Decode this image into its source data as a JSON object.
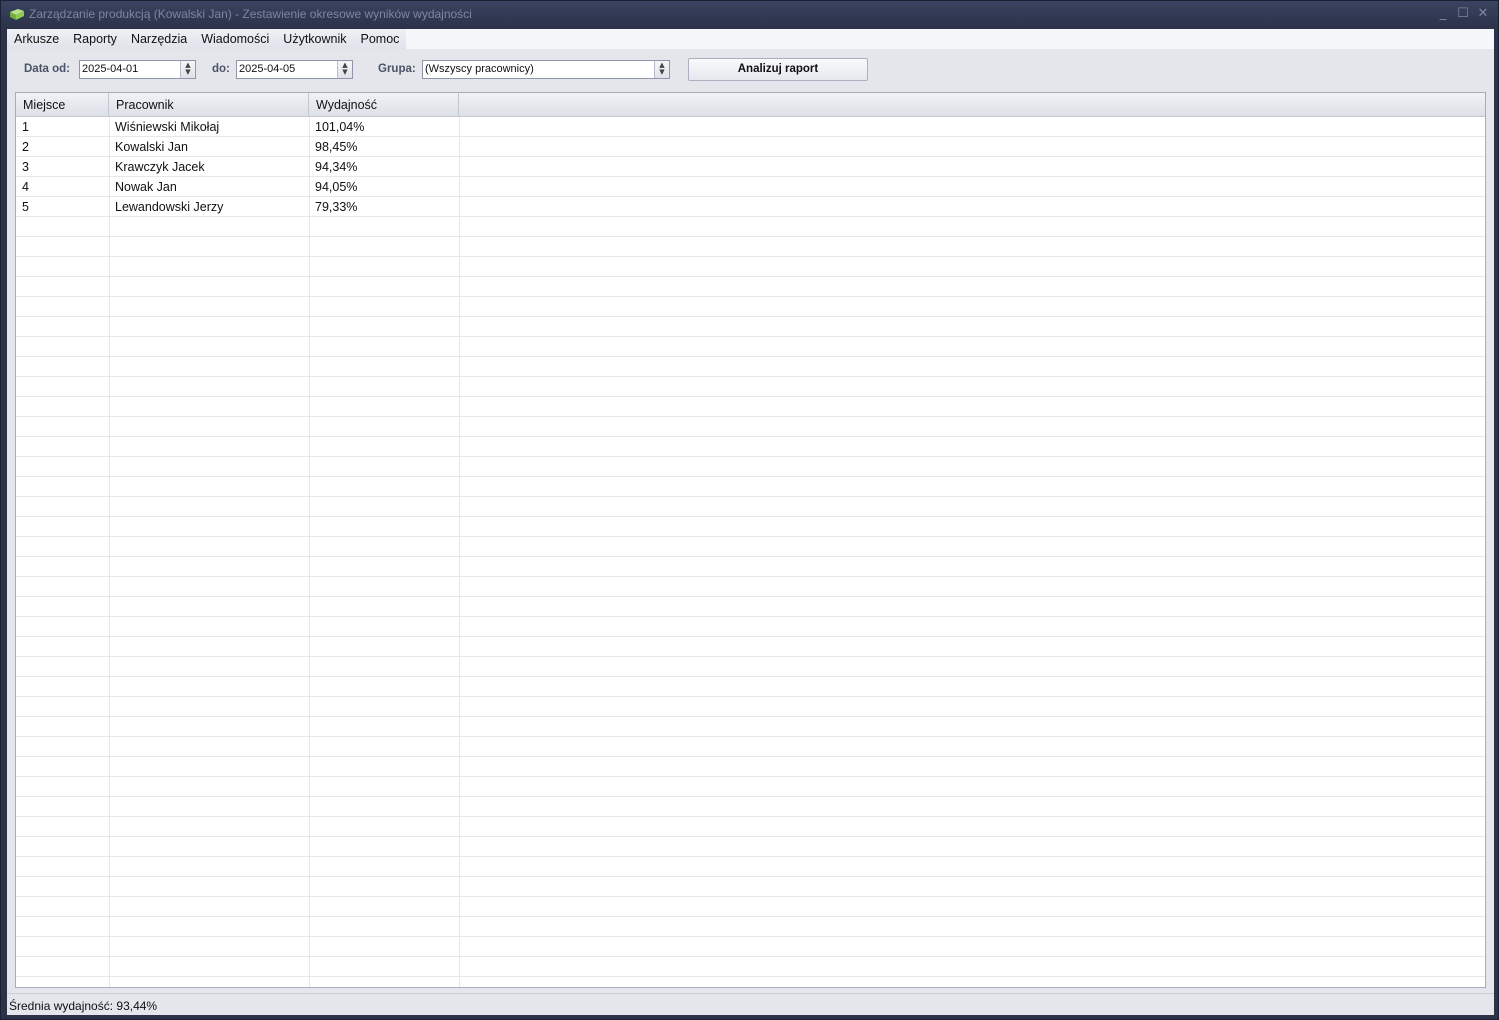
{
  "window": {
    "title": "Zarządzanie produkcją (Kowalski Jan) - Zestawienie okresowe wyników wydajności"
  },
  "menu": [
    "Arkusze",
    "Raporty",
    "Narzędzia",
    "Wiadomości",
    "Użytkownik",
    "Pomoc"
  ],
  "filters": {
    "date_from_label": "Data od:",
    "date_from_value": "2025-04-01",
    "date_to_label": "do:",
    "date_to_value": "2025-04-05",
    "group_label": "Grupa:",
    "group_value": "(Wszyscy pracownicy)",
    "analyze_button": "Analizuj raport"
  },
  "table": {
    "columns": [
      "Miejsce",
      "Pracownik",
      "Wydajność"
    ],
    "rows": [
      [
        "1",
        "Wiśniewski Mikołaj",
        "101,04%"
      ],
      [
        "2",
        "Kowalski Jan",
        "98,45%"
      ],
      [
        "3",
        "Krawczyk Jacek",
        "94,34%"
      ],
      [
        "4",
        "Nowak Jan",
        "94,05%"
      ],
      [
        "5",
        "Lewandowski Jerzy",
        "79,33%"
      ]
    ]
  },
  "status": {
    "average": "Średnia wydajność: 93,44%"
  }
}
